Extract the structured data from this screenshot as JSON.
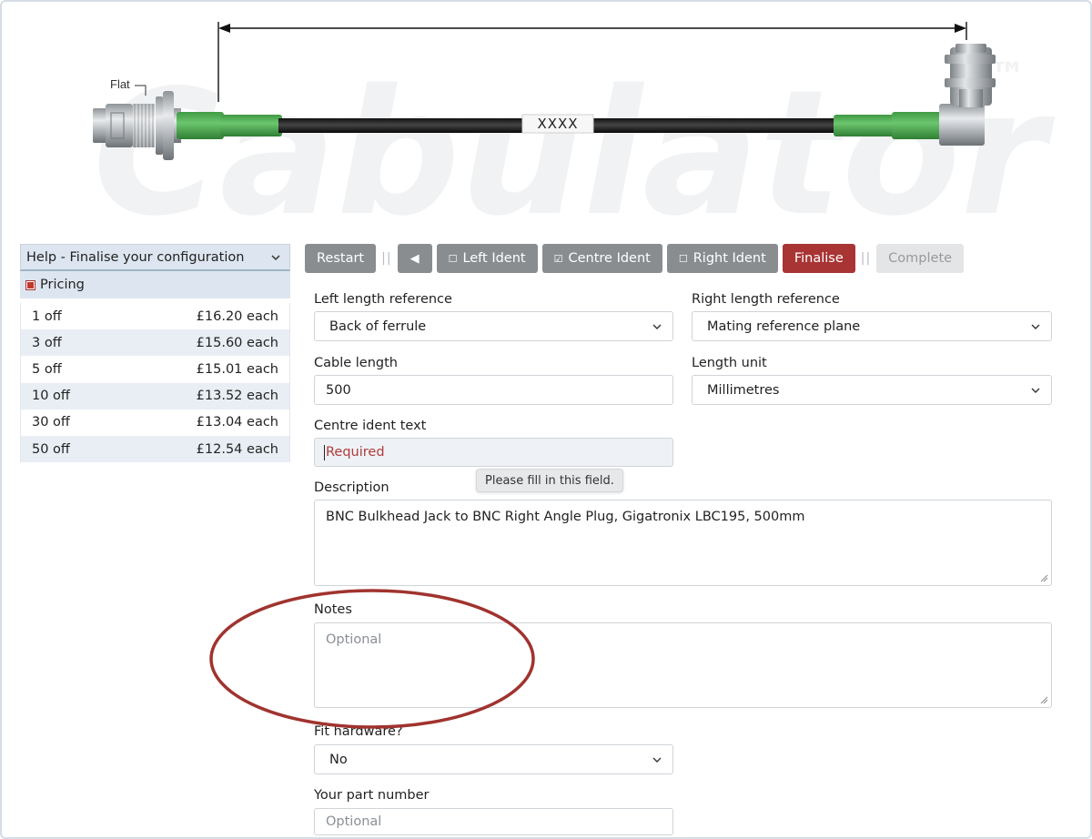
{
  "illustration": {
    "flat_label": "Flat",
    "centre_ident": "XXXX",
    "watermark": "Cabulator™"
  },
  "sidebar": {
    "help_title": "Help - Finalise your configuration",
    "pricing_label": "Pricing",
    "prices": [
      {
        "qty": "1 off",
        "price": "£16.20 each"
      },
      {
        "qty": "3 off",
        "price": "£15.60 each"
      },
      {
        "qty": "5 off",
        "price": "£15.01 each"
      },
      {
        "qty": "10 off",
        "price": "£13.52 each"
      },
      {
        "qty": "30 off",
        "price": "£13.04 each"
      },
      {
        "qty": "50 off",
        "price": "£12.54 each"
      }
    ]
  },
  "toolbar": {
    "restart": "Restart",
    "separator": "||",
    "back": "◀",
    "left_ident": "Left Ident",
    "left_ident_mark": "☐",
    "centre_ident": "Centre Ident",
    "centre_ident_mark": "☑",
    "right_ident": "Right Ident",
    "right_ident_mark": "☐",
    "finalise": "Finalise",
    "complete": "Complete"
  },
  "form": {
    "left_length_ref": {
      "label": "Left length reference",
      "value": "Back of ferrule"
    },
    "right_length_ref": {
      "label": "Right length reference",
      "value": "Mating reference plane"
    },
    "cable_length": {
      "label": "Cable length",
      "value": "500"
    },
    "length_unit": {
      "label": "Length unit",
      "value": "Millimetres"
    },
    "centre_ident_text": {
      "label": "Centre ident text",
      "placeholder": "Required"
    },
    "tooltip": "Please fill in this field.",
    "description": {
      "label": "Description",
      "value": "BNC Bulkhead Jack to BNC Right Angle Plug, Gigatronix LBC195, 500mm"
    },
    "notes": {
      "label": "Notes",
      "placeholder": "Optional"
    },
    "fit_hardware": {
      "label": "Fit hardware?",
      "value": "No"
    },
    "part_number": {
      "label": "Your part number",
      "placeholder": "Optional"
    }
  },
  "colors": {
    "finalise": "#a93434",
    "button_grey": "#8a8d90",
    "cable_green": "#4caf50",
    "annotation_ellipse": "#a0332f"
  }
}
